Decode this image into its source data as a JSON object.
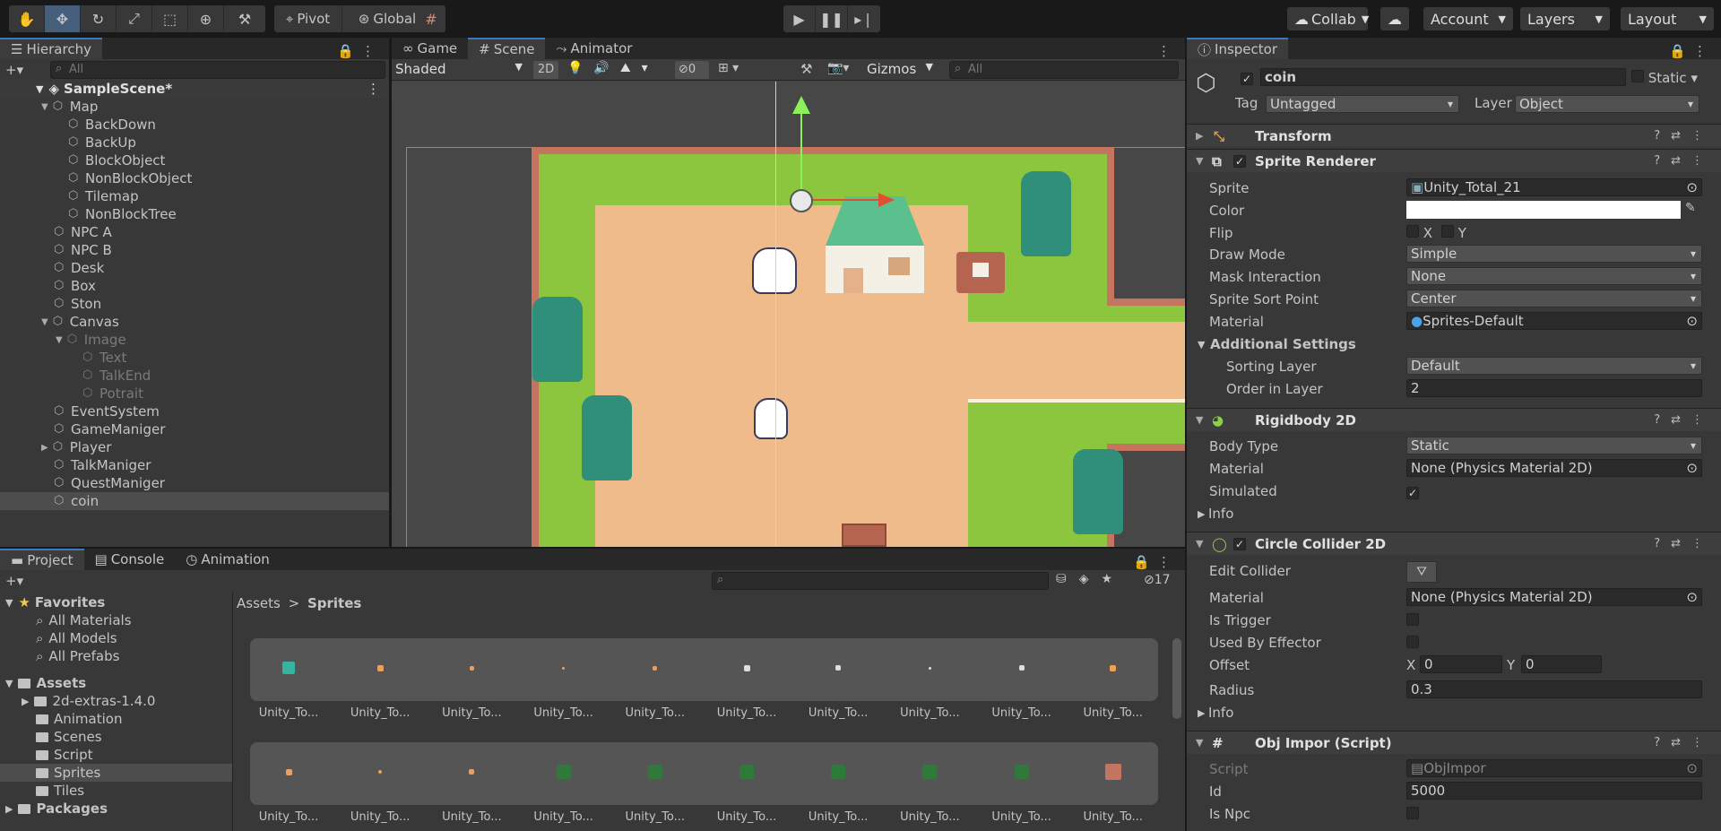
{
  "toolbar": {
    "tools": [
      "hand-tool",
      "move-tool",
      "rotate-tool",
      "scale-tool",
      "rect-tool",
      "transform-tool",
      "custom-tool"
    ],
    "pivot": "Pivot",
    "global": "Global",
    "collab": "Collab",
    "account": "Account",
    "layers": "Layers",
    "layout": "Layout"
  },
  "hierarchy": {
    "title": "Hierarchy",
    "search": "All",
    "scene": "SampleScene*",
    "items": [
      {
        "label": "Map",
        "indent": 1,
        "expand": "▼",
        "dim": false
      },
      {
        "label": "BackDown",
        "indent": 2,
        "expand": "",
        "dim": false
      },
      {
        "label": "BackUp",
        "indent": 2,
        "expand": "",
        "dim": false
      },
      {
        "label": "BlockObject",
        "indent": 2,
        "expand": "",
        "dim": false
      },
      {
        "label": "NonBlockObject",
        "indent": 2,
        "expand": "",
        "dim": false
      },
      {
        "label": "Tilemap",
        "indent": 2,
        "expand": "",
        "dim": false
      },
      {
        "label": "NonBlockTree",
        "indent": 2,
        "expand": "",
        "dim": false
      },
      {
        "label": "NPC A",
        "indent": 1,
        "expand": "",
        "dim": false
      },
      {
        "label": "NPC B",
        "indent": 1,
        "expand": "",
        "dim": false
      },
      {
        "label": "Desk",
        "indent": 1,
        "expand": "",
        "dim": false
      },
      {
        "label": "Box",
        "indent": 1,
        "expand": "",
        "dim": false
      },
      {
        "label": "Ston",
        "indent": 1,
        "expand": "",
        "dim": false
      },
      {
        "label": "Canvas",
        "indent": 1,
        "expand": "▼",
        "dim": false
      },
      {
        "label": "Image",
        "indent": 2,
        "expand": "▼",
        "dim": true
      },
      {
        "label": "Text",
        "indent": 3,
        "expand": "",
        "dim": true
      },
      {
        "label": "TalkEnd",
        "indent": 3,
        "expand": "",
        "dim": true
      },
      {
        "label": "Potrait",
        "indent": 3,
        "expand": "",
        "dim": true
      },
      {
        "label": "EventSystem",
        "indent": 1,
        "expand": "",
        "dim": false
      },
      {
        "label": "GameManiger",
        "indent": 1,
        "expand": "",
        "dim": false
      },
      {
        "label": "Player",
        "indent": 1,
        "expand": "▶",
        "dim": false
      },
      {
        "label": "TalkManiger",
        "indent": 1,
        "expand": "",
        "dim": false
      },
      {
        "label": "QuestManiger",
        "indent": 1,
        "expand": "",
        "dim": false
      },
      {
        "label": "coin",
        "indent": 1,
        "expand": "",
        "dim": false,
        "selected": true
      }
    ]
  },
  "sceneTabs": {
    "game": "Game",
    "scene": "Scene",
    "animator": "Animator"
  },
  "sceneBar": {
    "shading": "Shaded",
    "mode2d": "2D",
    "hidden_count": "0",
    "gizmos": "Gizmos",
    "search": "All"
  },
  "bottomTabs": {
    "project": "Project",
    "console": "Console",
    "animation": "Animation",
    "hidden_count": "17"
  },
  "project": {
    "favorites": "Favorites",
    "fav_items": [
      "All Materials",
      "All Models",
      "All Prefabs"
    ],
    "assets": "Assets",
    "asset_folders": [
      "2d-extras-1.4.0",
      "Animation",
      "Scenes",
      "Script",
      "Sprites",
      "Tiles"
    ],
    "packages": "Packages",
    "breadcrumb": [
      "Assets",
      "Sprites"
    ],
    "asset_label": "Unity_To..."
  },
  "inspector": {
    "title": "Inspector",
    "name": "coin",
    "static": "Static",
    "tag_label": "Tag",
    "tag": "Untagged",
    "layer_label": "Layer",
    "layer": "Object",
    "transform": "Transform",
    "sprite_renderer": {
      "title": "Sprite Renderer",
      "sprite_label": "Sprite",
      "sprite": "Unity_Total_21",
      "color_label": "Color",
      "flip_label": "Flip",
      "flip_x": "X",
      "flip_y": "Y",
      "draw_mode_label": "Draw Mode",
      "draw_mode": "Simple",
      "mask_label": "Mask Interaction",
      "mask": "None",
      "sort_point_label": "Sprite Sort Point",
      "sort_point": "Center",
      "material_label": "Material",
      "material": "Sprites-Default",
      "additional": "Additional Settings",
      "sorting_layer_label": "Sorting Layer",
      "sorting_layer": "Default",
      "order_label": "Order in Layer",
      "order": "2"
    },
    "rigidbody": {
      "title": "Rigidbody 2D",
      "body_type_label": "Body Type",
      "body_type": "Static",
      "material_label": "Material",
      "material": "None (Physics Material 2D)",
      "simulated_label": "Simulated",
      "info": "Info"
    },
    "collider": {
      "title": "Circle Collider 2D",
      "edit_label": "Edit Collider",
      "material_label": "Material",
      "material": "None (Physics Material 2D)",
      "trigger_label": "Is Trigger",
      "effector_label": "Used By Effector",
      "offset_label": "Offset",
      "offset_x_label": "X",
      "offset_x": "0",
      "offset_y_label": "Y",
      "offset_y": "0",
      "radius_label": "Radius",
      "radius": "0.3",
      "info": "Info"
    },
    "script": {
      "title": "Obj Impor (Script)",
      "script_label": "Script",
      "script": "ObjImpor",
      "id_label": "Id",
      "id": "5000",
      "npc_label": "Is Npc"
    }
  },
  "colors": {
    "accent": "#3a79bb",
    "selection": "#46607c",
    "grass": "#8cc63f",
    "path": "#efbb8a"
  }
}
